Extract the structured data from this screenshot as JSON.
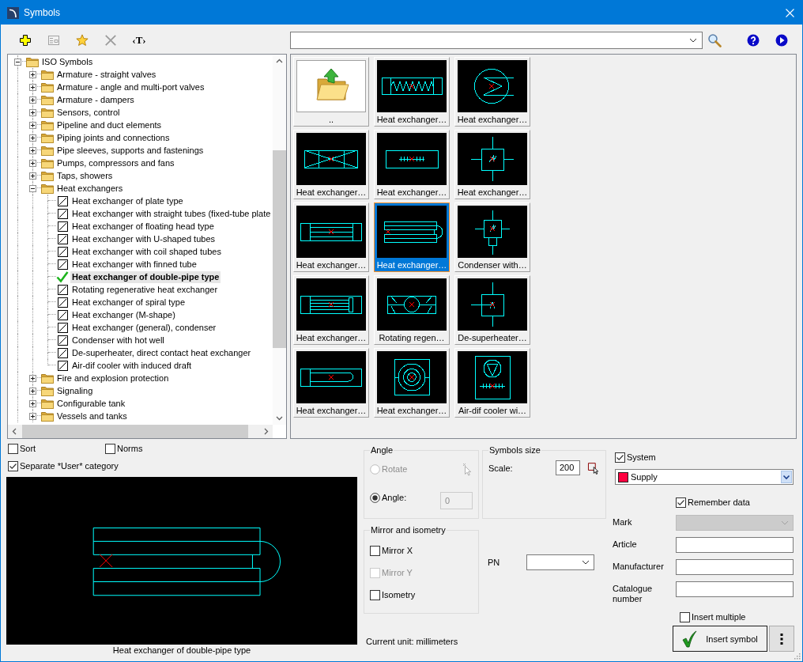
{
  "window": {
    "title": "Symbols"
  },
  "toolbar": {
    "buttons": [
      {
        "kind": "icon",
        "disabled": false
      },
      {
        "kind": "icon",
        "disabled": true
      },
      {
        "kind": "icon",
        "disabled": false
      },
      {
        "kind": "icon",
        "disabled": true
      },
      {
        "kind": "text",
        "label": "‹T›",
        "disabled": false
      }
    ]
  },
  "tree": {
    "items": [
      {
        "kind": "folder",
        "label": "ISO Symbols",
        "expanded": true,
        "children": [
          {
            "kind": "folder",
            "label": "Armature - straight valves",
            "expanded": false
          },
          {
            "kind": "folder",
            "label": "Armature - angle and multi-port valves",
            "expanded": false
          },
          {
            "kind": "folder",
            "label": "Armature - dampers",
            "expanded": false
          },
          {
            "kind": "folder",
            "label": "Sensors, control",
            "expanded": false
          },
          {
            "kind": "folder",
            "label": "Pipeline and duct elements",
            "expanded": false
          },
          {
            "kind": "folder",
            "label": "Piping joints and connections",
            "expanded": false
          },
          {
            "kind": "folder",
            "label": "Pipe sleeves, supports and fastenings",
            "expanded": false
          },
          {
            "kind": "folder",
            "label": "Pumps, compressors and fans",
            "expanded": false
          },
          {
            "kind": "folder",
            "label": "Taps, showers",
            "expanded": false
          },
          {
            "kind": "folder",
            "label": "Heat exchangers",
            "expanded": true,
            "children": [
              {
                "kind": "symbol",
                "label": "Heat exchanger of plate type",
                "selected": false
              },
              {
                "kind": "symbol",
                "label": "Heat exchanger with straight tubes (fixed-tube plate",
                "selected": false
              },
              {
                "kind": "symbol",
                "label": "Heat exchanger of floating head type",
                "selected": false
              },
              {
                "kind": "symbol",
                "label": "Heat exchanger with U-shaped tubes",
                "selected": false
              },
              {
                "kind": "symbol",
                "label": "Heat exchanger with coil shaped tubes",
                "selected": false
              },
              {
                "kind": "symbol",
                "label": "Heat exchanger with finned tube",
                "selected": false
              },
              {
                "kind": "symbol",
                "label": "Heat exchanger of double-pipe type",
                "selected": true
              },
              {
                "kind": "symbol",
                "label": "Rotating regenerative heat exchanger",
                "selected": false
              },
              {
                "kind": "symbol",
                "label": "Heat exchanger of spiral type",
                "selected": false
              },
              {
                "kind": "symbol",
                "label": "Heat exchanger (M-shape)",
                "selected": false
              },
              {
                "kind": "symbol",
                "label": "Heat exchanger (general), condenser",
                "selected": false
              },
              {
                "kind": "symbol",
                "label": "Condenser with hot well",
                "selected": false
              },
              {
                "kind": "symbol",
                "label": "De-superheater, direct contact heat exchanger",
                "selected": false
              },
              {
                "kind": "symbol",
                "label": "Air-dif cooler with induced draft",
                "selected": false
              }
            ]
          },
          {
            "kind": "folder",
            "label": "Fire and explosion protection",
            "expanded": false
          },
          {
            "kind": "folder",
            "label": "Signaling",
            "expanded": false
          },
          {
            "kind": "folder",
            "label": "Configurable tank",
            "expanded": false
          },
          {
            "kind": "folder",
            "label": "Vessels and tanks",
            "expanded": false
          }
        ]
      }
    ]
  },
  "tree_options": [
    {
      "label": "Sort",
      "checked": false
    },
    {
      "label": "Norms",
      "checked": false
    },
    {
      "label": "Separate *User* category",
      "checked": true
    }
  ],
  "thumbnails": [
    {
      "kind": "folder",
      "caption": "..",
      "selected": false
    },
    {
      "kind": "symbol",
      "caption": "Heat exchanger…",
      "selected": false
    },
    {
      "kind": "symbol",
      "caption": "Heat exchanger…",
      "selected": false
    },
    {
      "kind": "symbol",
      "caption": "Heat exchanger…",
      "selected": false
    },
    {
      "kind": "symbol",
      "caption": "Heat exchanger…",
      "selected": false
    },
    {
      "kind": "symbol",
      "caption": "Heat exchanger…",
      "selected": false
    },
    {
      "kind": "symbol",
      "caption": "Heat exchanger…",
      "selected": false
    },
    {
      "kind": "symbol",
      "caption": "Heat exchanger…",
      "selected": true
    },
    {
      "kind": "symbol",
      "caption": "Condenser with…",
      "selected": false
    },
    {
      "kind": "symbol",
      "caption": "Heat exchanger…",
      "selected": false
    },
    {
      "kind": "symbol",
      "caption": "Rotating regen…",
      "selected": false
    },
    {
      "kind": "symbol",
      "caption": "De-superheater…",
      "selected": false
    },
    {
      "kind": "symbol",
      "caption": "Heat exchanger…",
      "selected": false
    },
    {
      "kind": "symbol",
      "caption": "Heat exchanger…",
      "selected": false
    },
    {
      "kind": "symbol",
      "caption": "Air-dif cooler wi…",
      "selected": false
    }
  ],
  "preview": {
    "caption": "Heat exchanger of double-pipe type"
  },
  "angle": {
    "title": "Angle",
    "options": [
      {
        "label": "Rotate",
        "selected": false,
        "disabled": true
      },
      {
        "label": "Angle:",
        "selected": true,
        "disabled": false
      }
    ],
    "field": {
      "value": "0",
      "disabled": true
    }
  },
  "symbols_size": {
    "title": "Symbols size",
    "label": "Scale:",
    "value": "200"
  },
  "mirror": {
    "title": "Mirror and isometry",
    "options": [
      {
        "label": "Mirror X",
        "checked": false,
        "disabled": false
      },
      {
        "label": "Mirror Y",
        "checked": false,
        "disabled": true
      },
      {
        "label": "Isometry",
        "checked": false,
        "disabled": false
      }
    ]
  },
  "pn": {
    "label": "PN"
  },
  "current_unit": "Current unit: millimeters",
  "system": {
    "label": "System",
    "checked": true,
    "value": "Supply",
    "color": "#ff0040"
  },
  "remember_data": {
    "label": "Remember data",
    "checked": true
  },
  "fields": [
    {
      "label": "Mark",
      "kind": "dropdown",
      "disabled": true
    },
    {
      "label": "Article",
      "kind": "text",
      "disabled": false
    },
    {
      "label": "Manufacturer",
      "kind": "text",
      "disabled": false
    },
    {
      "label": "Catalogue number",
      "kind": "text",
      "disabled": false
    }
  ],
  "insert_multiple": {
    "label": "Insert multiple",
    "checked": false
  },
  "insert_button": {
    "label": "Insert symbol"
  }
}
